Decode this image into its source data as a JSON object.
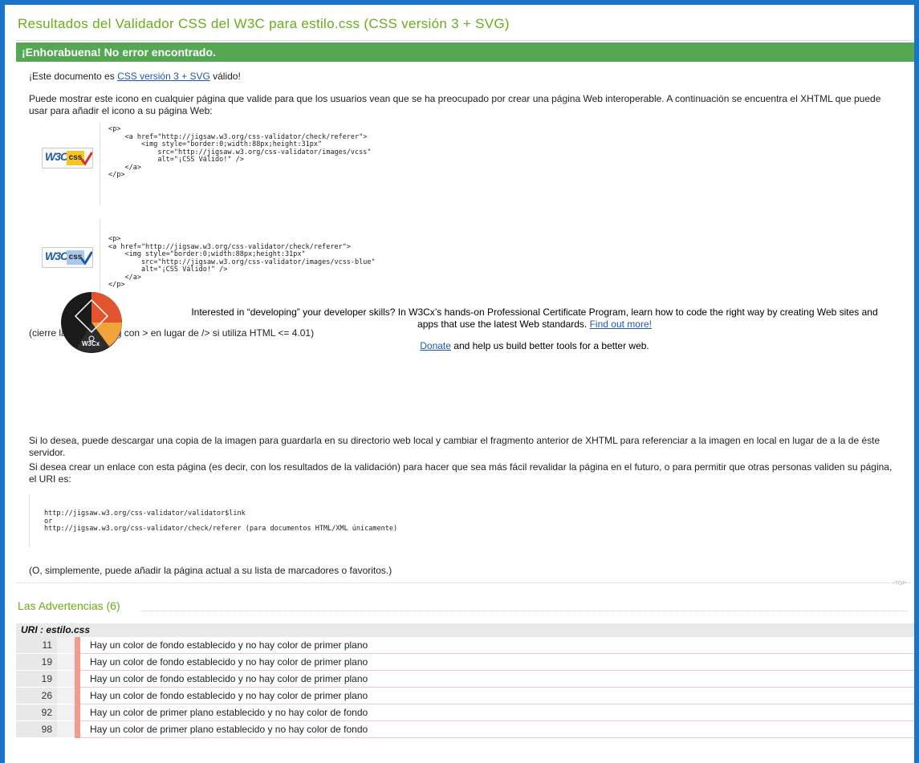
{
  "header": {
    "title": "Resultados del Validador CSS del W3C para estilo.css (CSS versión 3 + SVG)",
    "congrats": "¡Enhorabuena! No error encontrado."
  },
  "intro": {
    "valid_prefix": "¡Este documento es ",
    "valid_link": "CSS versión 3 + SVG",
    "valid_suffix": " válido!",
    "icon_text": "Puede mostrar este icono en cualquier página que valide para que los usuarios vean que se ha preocupado por crear una página Web interoperable. A continuación se encuentra el XHTML que puede usar para añadir el icono a su página Web:"
  },
  "badges": {
    "gold": {
      "w3c": "W3C",
      "css": "css",
      "color": "#f6c522"
    },
    "blue": {
      "w3c": "W3C",
      "css": "css",
      "color": "#a8c9ec"
    }
  },
  "code": {
    "gold_snippet": "<p>\n    <a href=\"http://jigsaw.w3.org/css-validator/check/referer\">\n        <img style=\"border:0;width:88px;height:31px\"\n            src=\"http://jigsaw.w3.org/css-validator/images/vcss\"\n            alt=\"¡CSS Válido!\" />\n    </a>\n</p>",
    "blue_snippet": "<p>\n<a href=\"http://jigsaw.w3.org/css-validator/check/referer\">\n    <img style=\"border:0;width:88px;height:31px\"\n        src=\"http://jigsaw.w3.org/css-validator/images/vcss-blue\"\n        alt=\"¡CSS Válido!\" />\n    </a>\n</p>"
  },
  "notes": {
    "close_tag": "(cierre la etiqueta img con > en lugar de /> si utiliza HTML <= 4.01)",
    "download": "Si lo desea, puede descargar una copia de la imagen para guardarla en su directorio web local y cambiar el fragmento anterior de XHTML para referenciar a la imagen en local en lugar de a la de éste servidor.",
    "link_text": "Si desea crear un enlace con esta página (es decir, con los resultados de la validación) para hacer que sea más fácil revalidar la página en el futuro, o para permitir que otras personas validen su página, el URI es:",
    "uri_snippet": "http://jigsaw.w3.org/css-validator/validator$link\nor\nhttp://jigsaw.w3.org/css-validator/check/referer (para documentos HTML/XML únicamente)",
    "bookmark": "(O, simplemente, puede añadir la página actual a su lista de marcadores o favoritos.)"
  },
  "promo": {
    "text": "Interested in “developing” your developer skills? In W3Cx’s hands-on Professional Certificate Program, learn how to code the right way by creating Web sites and apps that use the latest Web standards. ",
    "find_out": "Find out more!",
    "donate": "Donate",
    "donate_suffix": " and help us build better tools for a better web.",
    "logo_label": "W3Cx"
  },
  "top_link": "↑TOP",
  "warnings": {
    "title": "Las Advertencias (6)",
    "uri_label": "URI : estilo.css",
    "rows": [
      {
        "line": "11",
        "message": "Hay un color de fondo establecido y no hay color de primer plano"
      },
      {
        "line": "19",
        "message": "Hay un color de fondo establecido y no hay color de primer plano"
      },
      {
        "line": "19",
        "message": "Hay un color de fondo establecido y no hay color de primer plano"
      },
      {
        "line": "26",
        "message": "Hay un color de fondo establecido y no hay color de primer plano"
      },
      {
        "line": "92",
        "message": "Hay un color de primer plano establecido y no hay color de fondo"
      },
      {
        "line": "98",
        "message": "Hay un color de primer plano establecido y no hay color de fondo"
      }
    ]
  },
  "colors": {
    "accent": "#6bac19",
    "success_bar": "#55a754",
    "frame": "#1a74c5",
    "warning_mark": "#f29b8f"
  }
}
